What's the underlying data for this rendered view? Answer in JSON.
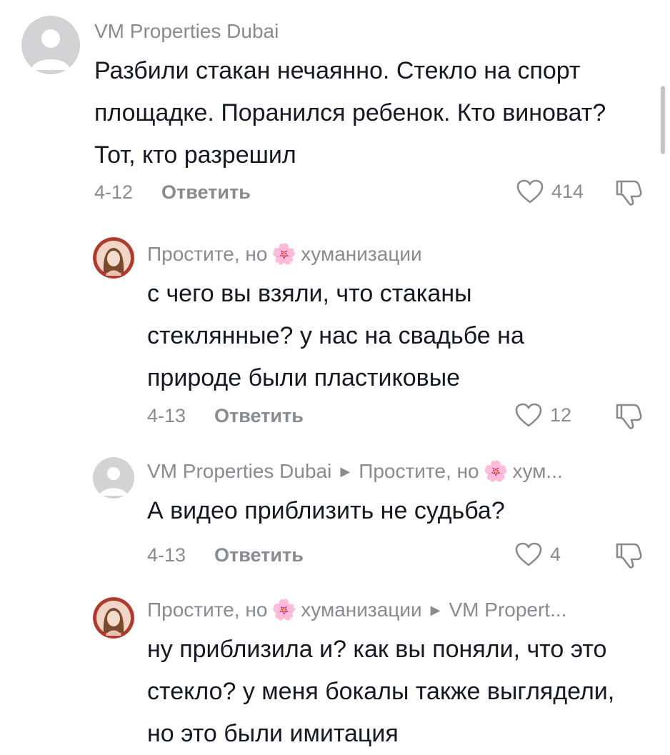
{
  "comments": [
    {
      "username": "VM Properties Dubai",
      "lines": [
        "Разбили стакан нечаянно. Стекло на спорт",
        "площадке. Поранился ребенок. Кто виноват?",
        "Тот, кто разрешил"
      ],
      "date": "4-12",
      "reply_label": "Ответить",
      "likes": "414"
    },
    {
      "username_before": "Простите, но",
      "username_after": "хуманизации",
      "lines": [
        "с чего вы взяли, что стаканы",
        "стеклянные? у нас на свадьбе на",
        "природе были пластиковые"
      ],
      "date": "4-13",
      "reply_label": "Ответить",
      "likes": "12"
    },
    {
      "username": "VM Properties Dubai",
      "reply_to_before": "Простите, но",
      "reply_to_after": "хум...",
      "lines": [
        "А видео приблизить не судьба?"
      ],
      "date": "4-13",
      "reply_label": "Ответить",
      "likes": "4"
    },
    {
      "username_before": "Простите, но",
      "username_after": "хуманизации",
      "reply_to": "VM Propert...",
      "lines": [
        "ну приблизила и? как вы поняли, что это",
        "стекло? у меня бокалы также выглядели,",
        "но это были имитация"
      ]
    }
  ],
  "icons": {
    "flower": "🌸",
    "reply_arrow": "▶",
    "like": "heart-outline-icon",
    "dislike": "thumbs-down-icon",
    "default_avatar": "person-placeholder-icon"
  },
  "colors": {
    "text": "#161823",
    "muted": "#8a8b91",
    "avatar_placeholder": "#d3d3d6"
  }
}
